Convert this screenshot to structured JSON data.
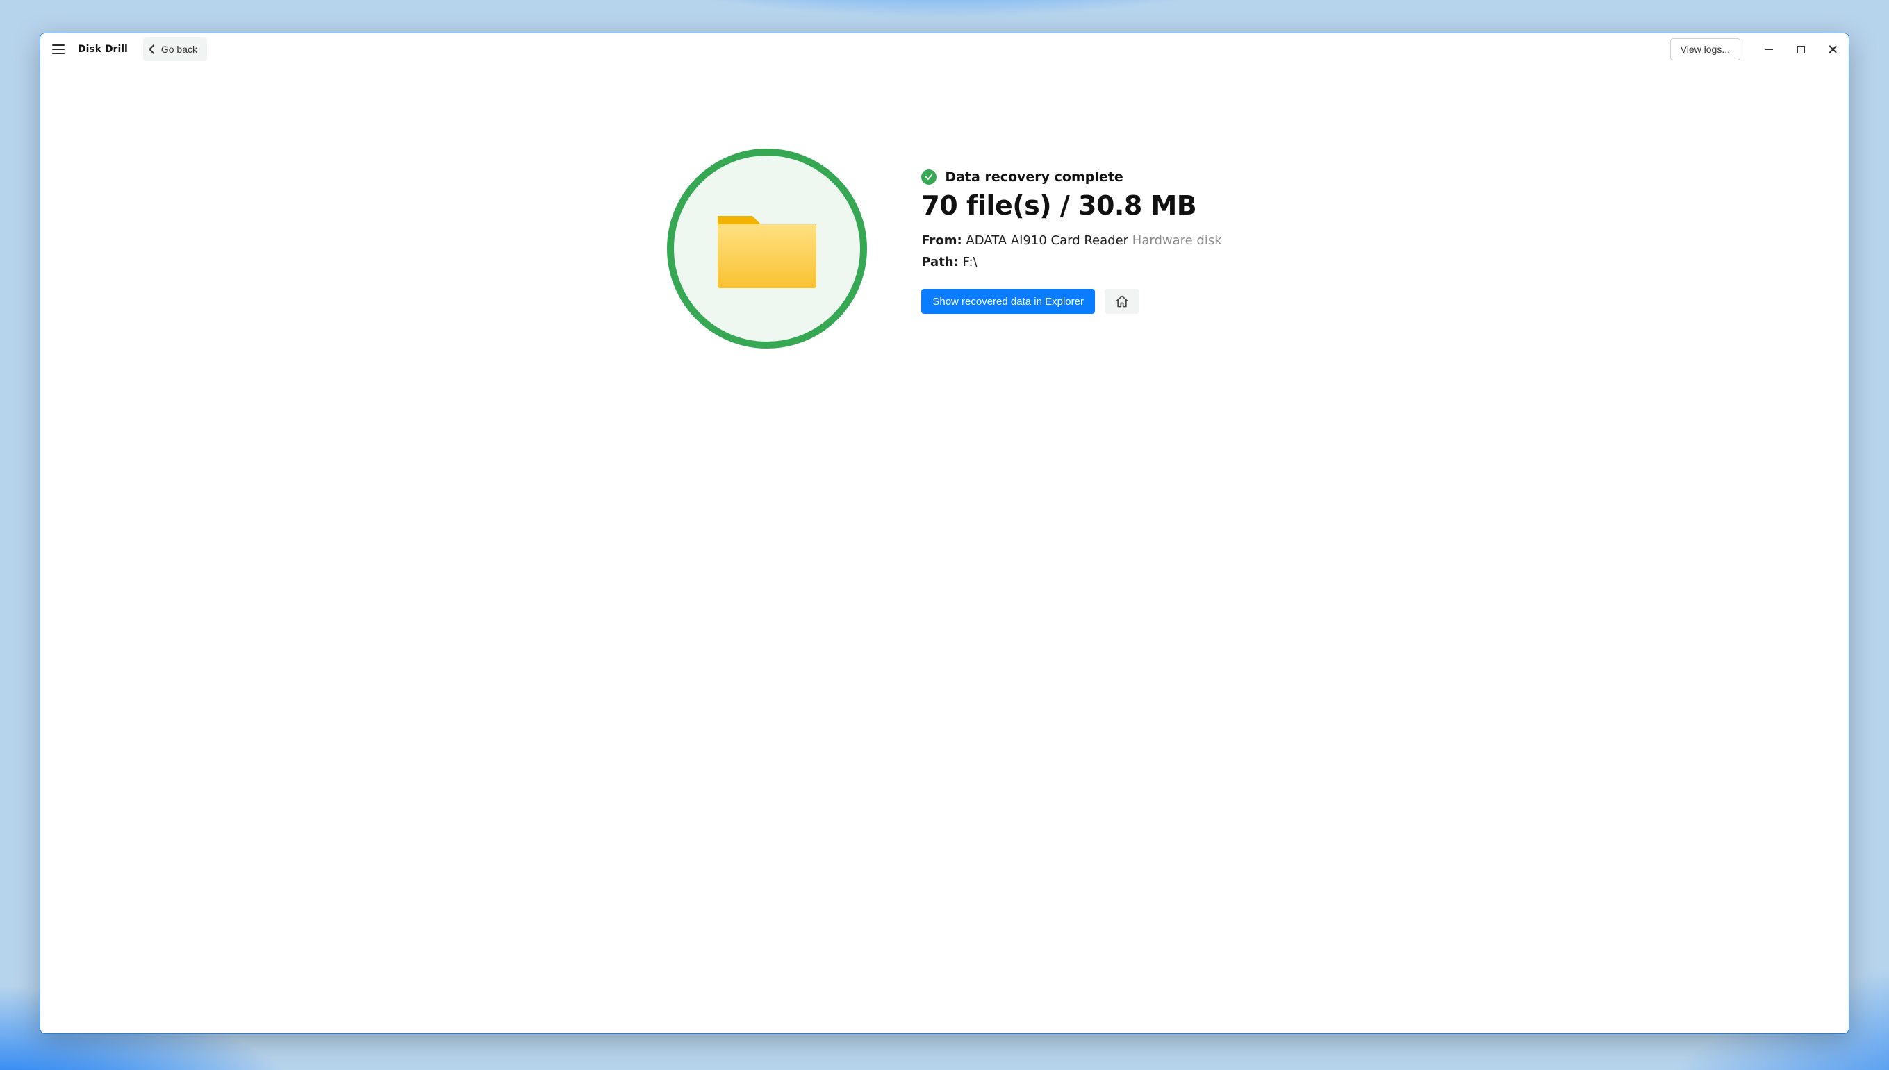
{
  "header": {
    "app_title": "Disk Drill",
    "go_back_label": "Go back",
    "view_logs_label": "View logs..."
  },
  "result": {
    "status_label": "Data recovery complete",
    "headline": "70 file(s) / 30.8 MB",
    "from_label": "From:",
    "from_device": "ADATA AI910 Card Reader",
    "from_type": "Hardware disk",
    "path_label": "Path:",
    "path_value": "F:\\",
    "show_button_label": "Show recovered data in Explorer"
  }
}
